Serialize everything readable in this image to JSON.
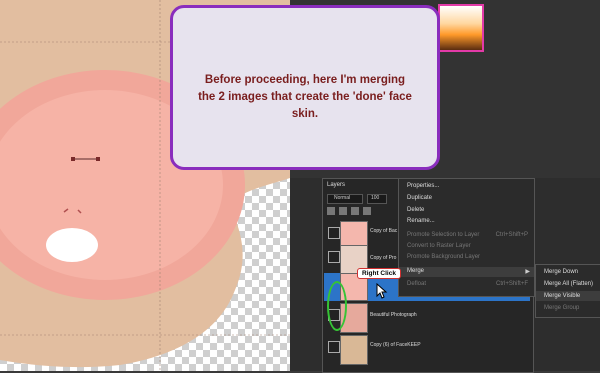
{
  "callout": {
    "text": "Before proceeding, here I'm merging the 2 images that create the 'done' face skin."
  },
  "layers_panel": {
    "title": "Layers",
    "blend_mode": "Normal",
    "opacity": "100",
    "layers": [
      {
        "name": "Copy of Bac"
      },
      {
        "name": "Copy of Pro"
      },
      {
        "name": "Beautiful Photograph"
      },
      {
        "name": "Copy (6) of FaceKEEP"
      }
    ]
  },
  "context_menu": {
    "items": [
      {
        "label": "Properties...",
        "enabled": true
      },
      {
        "label": "Duplicate",
        "enabled": true
      },
      {
        "label": "Delete",
        "enabled": true
      },
      {
        "label": "Rename...",
        "enabled": true
      },
      {
        "label": "Promote Selection to Layer",
        "shortcut": "Ctrl+Shift+P",
        "enabled": false
      },
      {
        "label": "Convert to Raster Layer",
        "enabled": false
      },
      {
        "label": "Promote Background Layer",
        "enabled": false
      },
      {
        "label": "Merge",
        "enabled": true
      },
      {
        "label": "Defloat",
        "shortcut": "Ctrl+Shift+F",
        "enabled": false
      }
    ]
  },
  "submenu": {
    "items": [
      {
        "label": "Merge Down",
        "enabled": true
      },
      {
        "label": "Merge All (Flatten)",
        "enabled": true
      },
      {
        "label": "Merge Visible",
        "enabled": true
      },
      {
        "label": "Merge Group",
        "enabled": false
      }
    ]
  },
  "right_click_label": "Right Click"
}
